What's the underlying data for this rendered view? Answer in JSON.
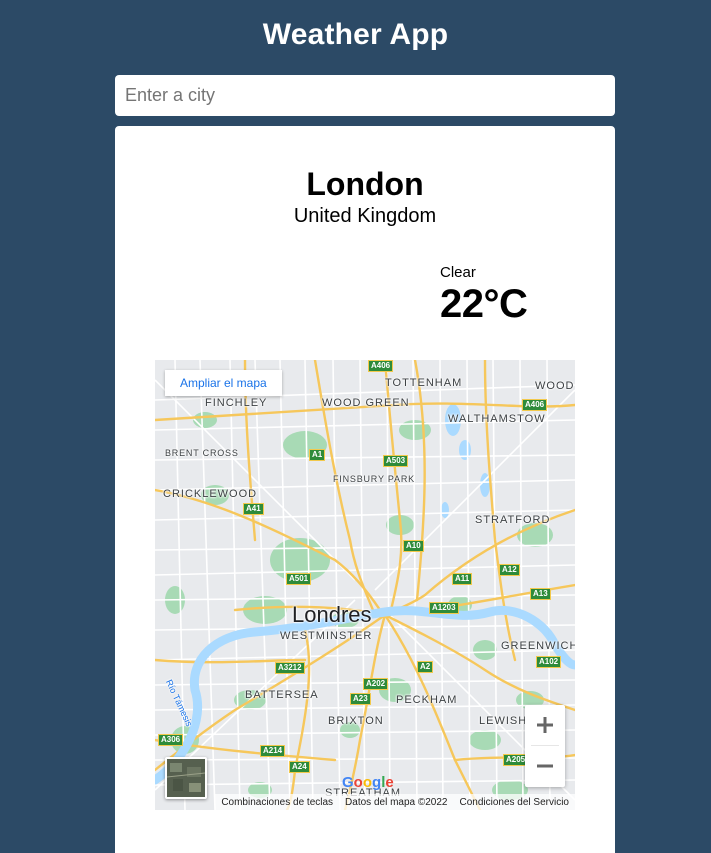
{
  "app": {
    "title": "Weather App"
  },
  "search": {
    "placeholder": "Enter a city",
    "value": ""
  },
  "weather": {
    "city": "London",
    "country": "United Kingdom",
    "condition": "Clear",
    "temperature": "22°C",
    "icon": "moon-icon"
  },
  "map": {
    "expand_link": "Ampliar el mapa",
    "center_label": "Londres",
    "labels": {
      "tottenham": "TOTTENHAM",
      "wood": "WOOD",
      "finchley": "FINCHLEY",
      "wood_green": "WOOD GREEN",
      "walthamstow": "WALTHAMSTOW",
      "brent_cross": "BRENT CROSS",
      "finsbury_park": "FINSBURY PARK",
      "cricklewood": "CRICKLEWOOD",
      "stratford": "STRATFORD",
      "westminster": "WESTMINSTER",
      "greenwich": "GREENWICH",
      "battersea": "BATTERSEA",
      "peckham": "PECKHAM",
      "brixton": "BRIXTON",
      "lewisham": "LEWISH",
      "streatham": "STREATHAM",
      "river": "Río Támesis"
    },
    "roads": {
      "a406_top": "A406",
      "a406": "A406",
      "a1": "A1",
      "a503": "A503",
      "a41": "A41",
      "a10": "A10",
      "a12": "A12",
      "a11": "A11",
      "a13": "A13",
      "a501": "A501",
      "a1203": "A1203",
      "a102": "A102",
      "a3212": "A3212",
      "a2": "A2",
      "a202": "A202",
      "a23": "A23",
      "a306": "A306",
      "a214": "A214",
      "a24": "A24",
      "a205": "A205"
    },
    "footer": {
      "shortcuts": "Combinaciones de teclas",
      "data": "Datos del mapa ©2022",
      "terms": "Condiciones del Servicio"
    },
    "google": {
      "g1": "G",
      "o1": "o",
      "o2": "o",
      "g2": "g",
      "l": "l",
      "e": "e"
    },
    "zoom_in_icon": "plus-icon",
    "zoom_out_icon": "minus-icon",
    "colors": {
      "road": "#f6c75b",
      "park": "#a8dab5",
      "water": "#aadaff",
      "land": "#e8eaed"
    }
  },
  "colors": {
    "background": "#2c4a66",
    "card": "#ffffff",
    "moon": "#1565c0"
  }
}
